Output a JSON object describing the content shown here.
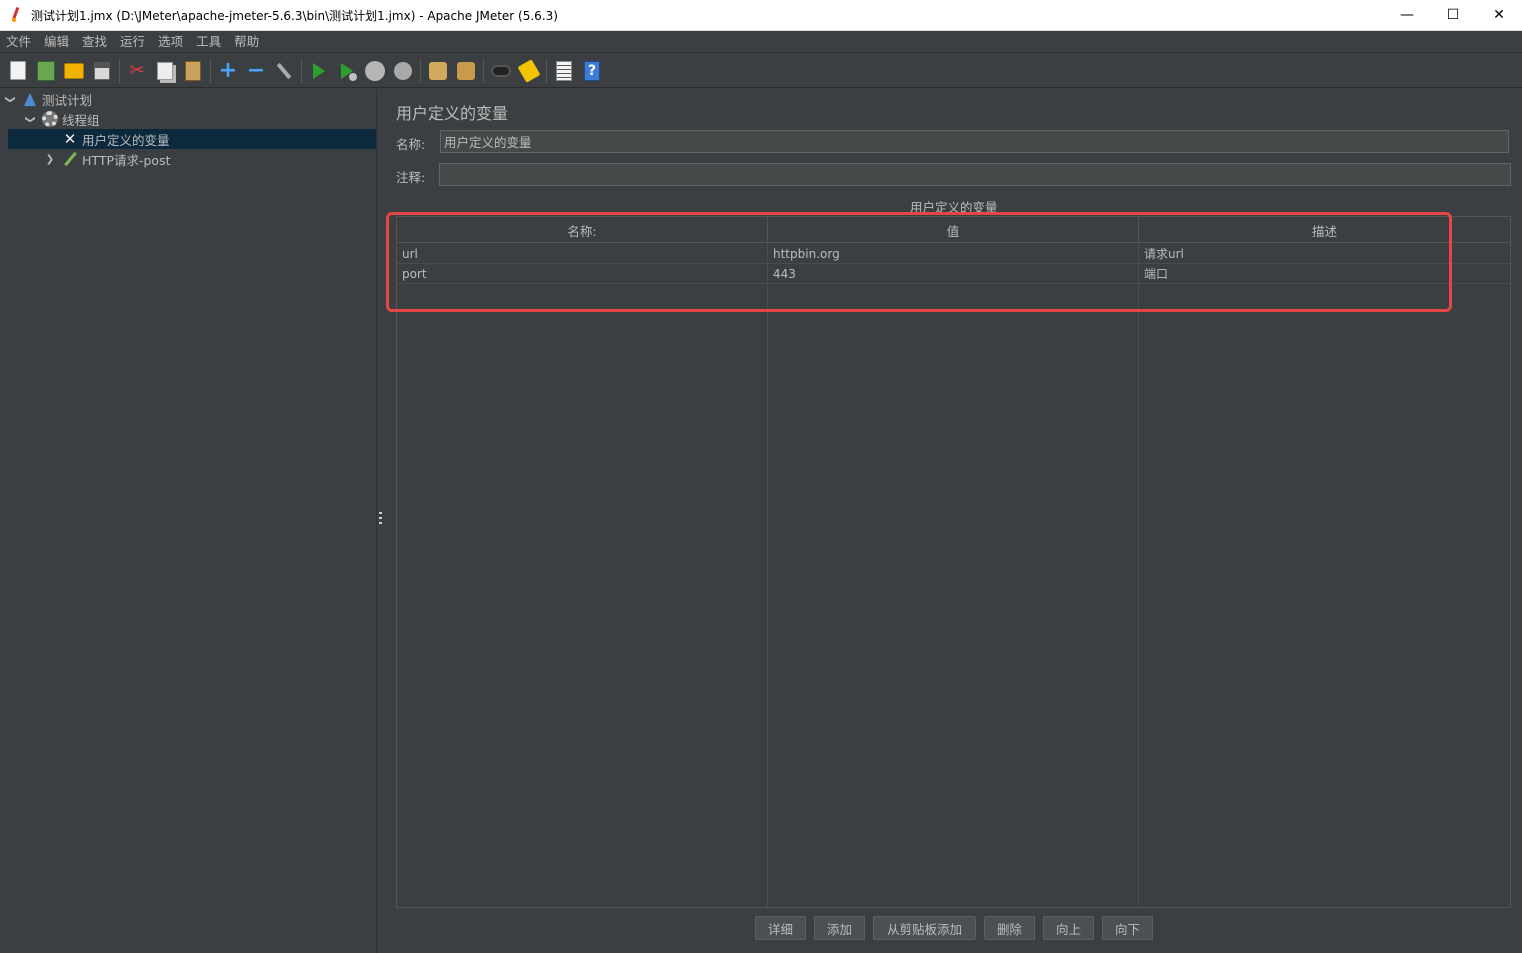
{
  "window": {
    "title": "测试计划1.jmx (D:\\JMeter\\apache-jmeter-5.6.3\\bin\\测试计划1.jmx) - Apache JMeter (5.6.3)",
    "minimize": "—",
    "maximize": "☐",
    "close": "✕"
  },
  "menu": [
    "文件",
    "编辑",
    "查找",
    "运行",
    "选项",
    "工具",
    "帮助"
  ],
  "toolbar": {
    "icons": [
      "new-icon",
      "templates-icon",
      "open-icon",
      "save-icon",
      "cut-icon",
      "copy-icon",
      "paste-icon",
      "expand-icon",
      "collapse-icon",
      "toggle-icon",
      "start-icon",
      "start-no-pause-icon",
      "stop-icon",
      "shutdown-icon",
      "clear-icon",
      "clear-all-icon",
      "search-icon",
      "reset-search-icon",
      "function-helper-icon",
      "help-icon"
    ]
  },
  "tree": {
    "items": [
      {
        "label": "测试计划",
        "level": 0,
        "expanded": true,
        "icon": "test-plan-icon"
      },
      {
        "label": "线程组",
        "level": 1,
        "expanded": true,
        "icon": "thread-group-icon"
      },
      {
        "label": "用户定义的变量",
        "level": 2,
        "selected": true,
        "icon": "config-element-icon"
      },
      {
        "label": "HTTP请求-post",
        "level": 2,
        "expanded": false,
        "icon": "sampler-icon"
      }
    ]
  },
  "editor": {
    "title": "用户定义的变量",
    "name_label": "名称:",
    "name_value": "用户定义的变量",
    "comment_label": "注释:",
    "comment_value": "",
    "section_title": "用户定义的变量"
  },
  "table": {
    "headers": [
      "名称:",
      "值",
      "描述"
    ],
    "rows": [
      [
        "url",
        "httpbin.org",
        "请求url"
      ],
      [
        "port",
        "443",
        "端口"
      ]
    ]
  },
  "buttons": {
    "detail": "详细",
    "add": "添加",
    "add_clipboard": "从剪贴板添加",
    "delete": "删除",
    "up": "向上",
    "down": "向下"
  },
  "colors": {
    "background": "#3c3f41",
    "selection": "#0d293e",
    "highlight_box": "#e64545"
  }
}
